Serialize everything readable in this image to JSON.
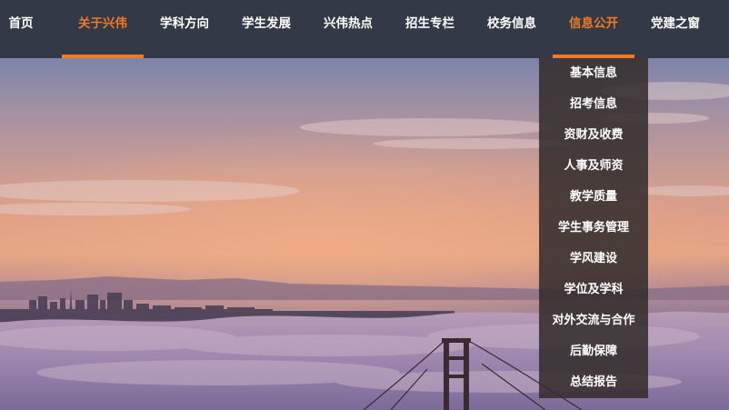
{
  "colors": {
    "nav_background": "#333947",
    "accent": "#f07b23",
    "dropdown_background": "#342e2e"
  },
  "nav": {
    "items": [
      {
        "label": "首页"
      },
      {
        "label": "关于兴伟"
      },
      {
        "label": "学科方向"
      },
      {
        "label": "学生发展"
      },
      {
        "label": "兴伟热点"
      },
      {
        "label": "招生专栏"
      },
      {
        "label": "校务信息"
      },
      {
        "label": "信息公开"
      },
      {
        "label": "党建之窗"
      }
    ]
  },
  "dropdown": {
    "items": [
      {
        "label": "基本信息"
      },
      {
        "label": "招考信息"
      },
      {
        "label": "资财及收费"
      },
      {
        "label": "人事及师资"
      },
      {
        "label": "教学质量"
      },
      {
        "label": "学生事务管理"
      },
      {
        "label": "学风建设"
      },
      {
        "label": "学位及学科"
      },
      {
        "label": "对外交流与合作"
      },
      {
        "label": "后勤保障"
      },
      {
        "label": "总结报告"
      }
    ]
  }
}
